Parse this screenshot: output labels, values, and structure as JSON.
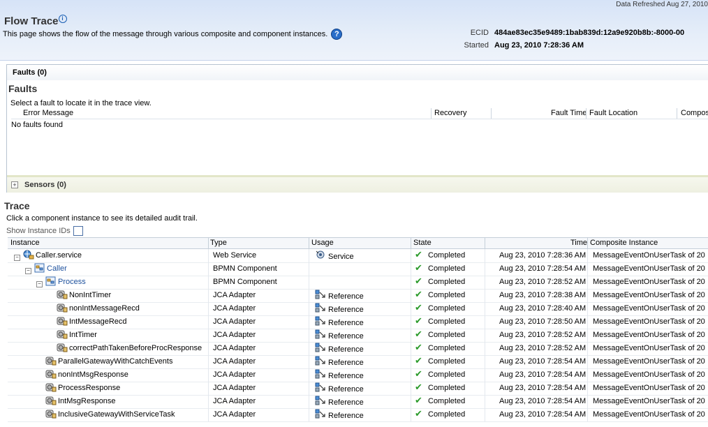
{
  "header": {
    "refreshed": "Data Refreshed Aug 27, 2010",
    "title": "Flow Trace",
    "description": "This page shows the flow of the message through various composite and component instances.",
    "ecid_label": "ECID",
    "ecid_value": "484ae83ec35e9489:1bab839d:12a9e920b8b:-8000-00",
    "started_label": "Started",
    "started_value": "Aug 23, 2010 7:28:36 AM"
  },
  "faults": {
    "tab_label": "Faults (0)",
    "heading": "Faults",
    "subtitle": "Select a fault to locate it in the trace view.",
    "columns": [
      "Error Message",
      "Recovery",
      "Fault Time",
      "Fault Location",
      "Composi"
    ],
    "empty_text": "No faults found"
  },
  "sensors": {
    "label": "Sensors (0)"
  },
  "trace": {
    "heading": "Trace",
    "subtitle": "Click a component instance to see its detailed audit trail.",
    "show_ids_label": "Show Instance IDs",
    "columns": [
      "Instance",
      "Type",
      "Usage",
      "State",
      "Time",
      "Composite Instance"
    ],
    "rows": [
      {
        "instance": "Caller.service",
        "type": "Web Service",
        "usage": "Service",
        "state": "Completed",
        "time": "Aug 23, 2010 7:28:36 AM",
        "composite": "MessageEventOnUserTask of 20"
      },
      {
        "instance": "Caller",
        "type": "BPMN Component",
        "usage": "",
        "state": "Completed",
        "time": "Aug 23, 2010 7:28:54 AM",
        "composite": "MessageEventOnUserTask of 20"
      },
      {
        "instance": "Process",
        "type": "BPMN Component",
        "usage": "",
        "state": "Completed",
        "time": "Aug 23, 2010 7:28:52 AM",
        "composite": "MessageEventOnUserTask of 20"
      },
      {
        "instance": "NonIntTimer",
        "type": "JCA Adapter",
        "usage": "Reference",
        "state": "Completed",
        "time": "Aug 23, 2010 7:28:38 AM",
        "composite": "MessageEventOnUserTask of 20"
      },
      {
        "instance": "nonIntMessageRecd",
        "type": "JCA Adapter",
        "usage": "Reference",
        "state": "Completed",
        "time": "Aug 23, 2010 7:28:40 AM",
        "composite": "MessageEventOnUserTask of 20"
      },
      {
        "instance": "IntMessageRecd",
        "type": "JCA Adapter",
        "usage": "Reference",
        "state": "Completed",
        "time": "Aug 23, 2010 7:28:50 AM",
        "composite": "MessageEventOnUserTask of 20"
      },
      {
        "instance": "IntTimer",
        "type": "JCA Adapter",
        "usage": "Reference",
        "state": "Completed",
        "time": "Aug 23, 2010 7:28:52 AM",
        "composite": "MessageEventOnUserTask of 20"
      },
      {
        "instance": "correctPathTakenBeforeProcResponse",
        "type": "JCA Adapter",
        "usage": "Reference",
        "state": "Completed",
        "time": "Aug 23, 2010 7:28:52 AM",
        "composite": "MessageEventOnUserTask of 20"
      },
      {
        "instance": "ParallelGatewayWithCatchEvents",
        "type": "JCA Adapter",
        "usage": "Reference",
        "state": "Completed",
        "time": "Aug 23, 2010 7:28:54 AM",
        "composite": "MessageEventOnUserTask of 20"
      },
      {
        "instance": "nonIntMsgResponse",
        "type": "JCA Adapter",
        "usage": "Reference",
        "state": "Completed",
        "time": "Aug 23, 2010 7:28:54 AM",
        "composite": "MessageEventOnUserTask of 20"
      },
      {
        "instance": "ProcessResponse",
        "type": "JCA Adapter",
        "usage": "Reference",
        "state": "Completed",
        "time": "Aug 23, 2010 7:28:54 AM",
        "composite": "MessageEventOnUserTask of 20"
      },
      {
        "instance": "IntMsgResponse",
        "type": "JCA Adapter",
        "usage": "Reference",
        "state": "Completed",
        "time": "Aug 23, 2010 7:28:54 AM",
        "composite": "MessageEventOnUserTask of 20"
      },
      {
        "instance": "InclusiveGatewayWithServiceTask",
        "type": "JCA Adapter",
        "usage": "Reference",
        "state": "Completed",
        "time": "Aug 23, 2010 7:28:54 AM",
        "composite": "MessageEventOnUserTask of 20"
      }
    ]
  }
}
